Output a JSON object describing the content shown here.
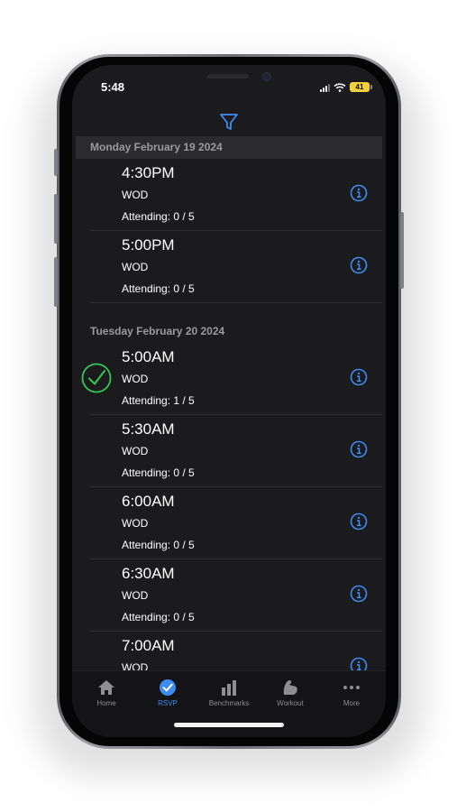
{
  "status": {
    "time": "5:48",
    "battery": "41"
  },
  "sections": [
    {
      "date": "Monday  February 19 2024",
      "classes": [
        {
          "time": "4:30PM",
          "type": "WOD",
          "attending": "Attending: 0 / 5"
        },
        {
          "time": "5:00PM",
          "type": "WOD",
          "attending": "Attending: 0 / 5"
        }
      ]
    },
    {
      "date": "Tuesday  February 20 2024",
      "classes": [
        {
          "time": "5:00AM",
          "type": "WOD",
          "attending": "Attending: 1 / 5",
          "rsvped": true
        },
        {
          "time": "5:30AM",
          "type": "WOD",
          "attending": "Attending: 0 / 5"
        },
        {
          "time": "6:00AM",
          "type": "WOD",
          "attending": "Attending: 0 / 5"
        },
        {
          "time": "6:30AM",
          "type": "WOD",
          "attending": "Attending: 0 / 5"
        },
        {
          "time": "7:00AM",
          "type": "WOD",
          "attending": ""
        }
      ]
    }
  ],
  "tabs": [
    {
      "label": "Home",
      "icon": "house-icon",
      "active": false
    },
    {
      "label": "RSVP",
      "icon": "check-circle-icon",
      "active": true
    },
    {
      "label": "Benchmarks",
      "icon": "bar-chart-icon",
      "active": false
    },
    {
      "label": "Workout",
      "icon": "flexed-arm-icon",
      "active": false
    },
    {
      "label": "More",
      "icon": "ellipsis-icon",
      "active": false
    }
  ],
  "colors": {
    "accent": "#3d8cf0",
    "check": "#34c759",
    "background": "#1b1b1d",
    "battery": "#f4d03f"
  }
}
